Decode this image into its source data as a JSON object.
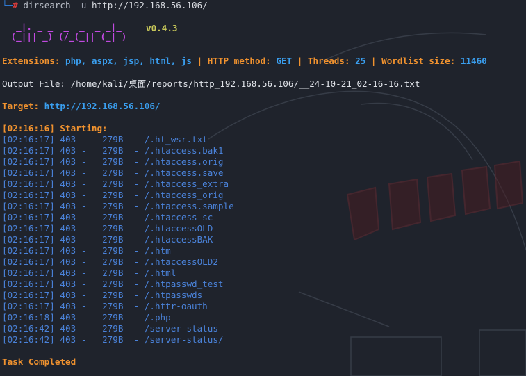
{
  "prompt": {
    "corner": "└─",
    "hash": "#",
    "command": "dirsearch",
    "option": "-u",
    "url": "http://192.168.56.106/"
  },
  "banner": {
    "line1": "  _|. _ _  _  _  _ _|_",
    "line2": " (_||| _) (/_(_|| (_| )",
    "version": "v0.4.3"
  },
  "config": {
    "extensions_label": "Extensions:",
    "extensions_value": "php, aspx, jsp, html, js",
    "sep1": "|",
    "method_label": "HTTP method:",
    "method_value": "GET",
    "sep2": "|",
    "threads_label": "Threads:",
    "threads_value": "25",
    "sep3": "|",
    "wordlist_label": "Wordlist size:",
    "wordlist_value": "11460"
  },
  "output_file": "Output File: /home/kali/桌面/reports/http_192.168.56.106/__24-10-21_02-16-16.txt",
  "target": {
    "label": "Target:",
    "value": "http://192.168.56.106/"
  },
  "starting": "[02:16:16] Starting:",
  "results": [
    {
      "time": "[02:16:17]",
      "status": "403",
      "size": "279B",
      "path": "/.ht_wsr.txt"
    },
    {
      "time": "[02:16:17]",
      "status": "403",
      "size": "279B",
      "path": "/.htaccess.bak1"
    },
    {
      "time": "[02:16:17]",
      "status": "403",
      "size": "279B",
      "path": "/.htaccess.orig"
    },
    {
      "time": "[02:16:17]",
      "status": "403",
      "size": "279B",
      "path": "/.htaccess.save"
    },
    {
      "time": "[02:16:17]",
      "status": "403",
      "size": "279B",
      "path": "/.htaccess_extra"
    },
    {
      "time": "[02:16:17]",
      "status": "403",
      "size": "279B",
      "path": "/.htaccess_orig"
    },
    {
      "time": "[02:16:17]",
      "status": "403",
      "size": "279B",
      "path": "/.htaccess.sample"
    },
    {
      "time": "[02:16:17]",
      "status": "403",
      "size": "279B",
      "path": "/.htaccess_sc"
    },
    {
      "time": "[02:16:17]",
      "status": "403",
      "size": "279B",
      "path": "/.htaccessOLD"
    },
    {
      "time": "[02:16:17]",
      "status": "403",
      "size": "279B",
      "path": "/.htaccessBAK"
    },
    {
      "time": "[02:16:17]",
      "status": "403",
      "size": "279B",
      "path": "/.htm"
    },
    {
      "time": "[02:16:17]",
      "status": "403",
      "size": "279B",
      "path": "/.htaccessOLD2"
    },
    {
      "time": "[02:16:17]",
      "status": "403",
      "size": "279B",
      "path": "/.html"
    },
    {
      "time": "[02:16:17]",
      "status": "403",
      "size": "279B",
      "path": "/.htpasswd_test"
    },
    {
      "time": "[02:16:17]",
      "status": "403",
      "size": "279B",
      "path": "/.htpasswds"
    },
    {
      "time": "[02:16:17]",
      "status": "403",
      "size": "279B",
      "path": "/.httr-oauth"
    },
    {
      "time": "[02:16:18]",
      "status": "403",
      "size": "279B",
      "path": "/.php"
    },
    {
      "time": "[02:16:42]",
      "status": "403",
      "size": "279B",
      "path": "/server-status"
    },
    {
      "time": "[02:16:42]",
      "status": "403",
      "size": "279B",
      "path": "/server-status/"
    }
  ],
  "task_completed": "Task Completed",
  "colors": {
    "background": "#1f232c",
    "orange": "#f0922f",
    "blue": "#3a9ff0",
    "log_blue": "#4a82d9",
    "banner_purple": "#c14ae0",
    "version_yellow": "#c9c95a"
  }
}
